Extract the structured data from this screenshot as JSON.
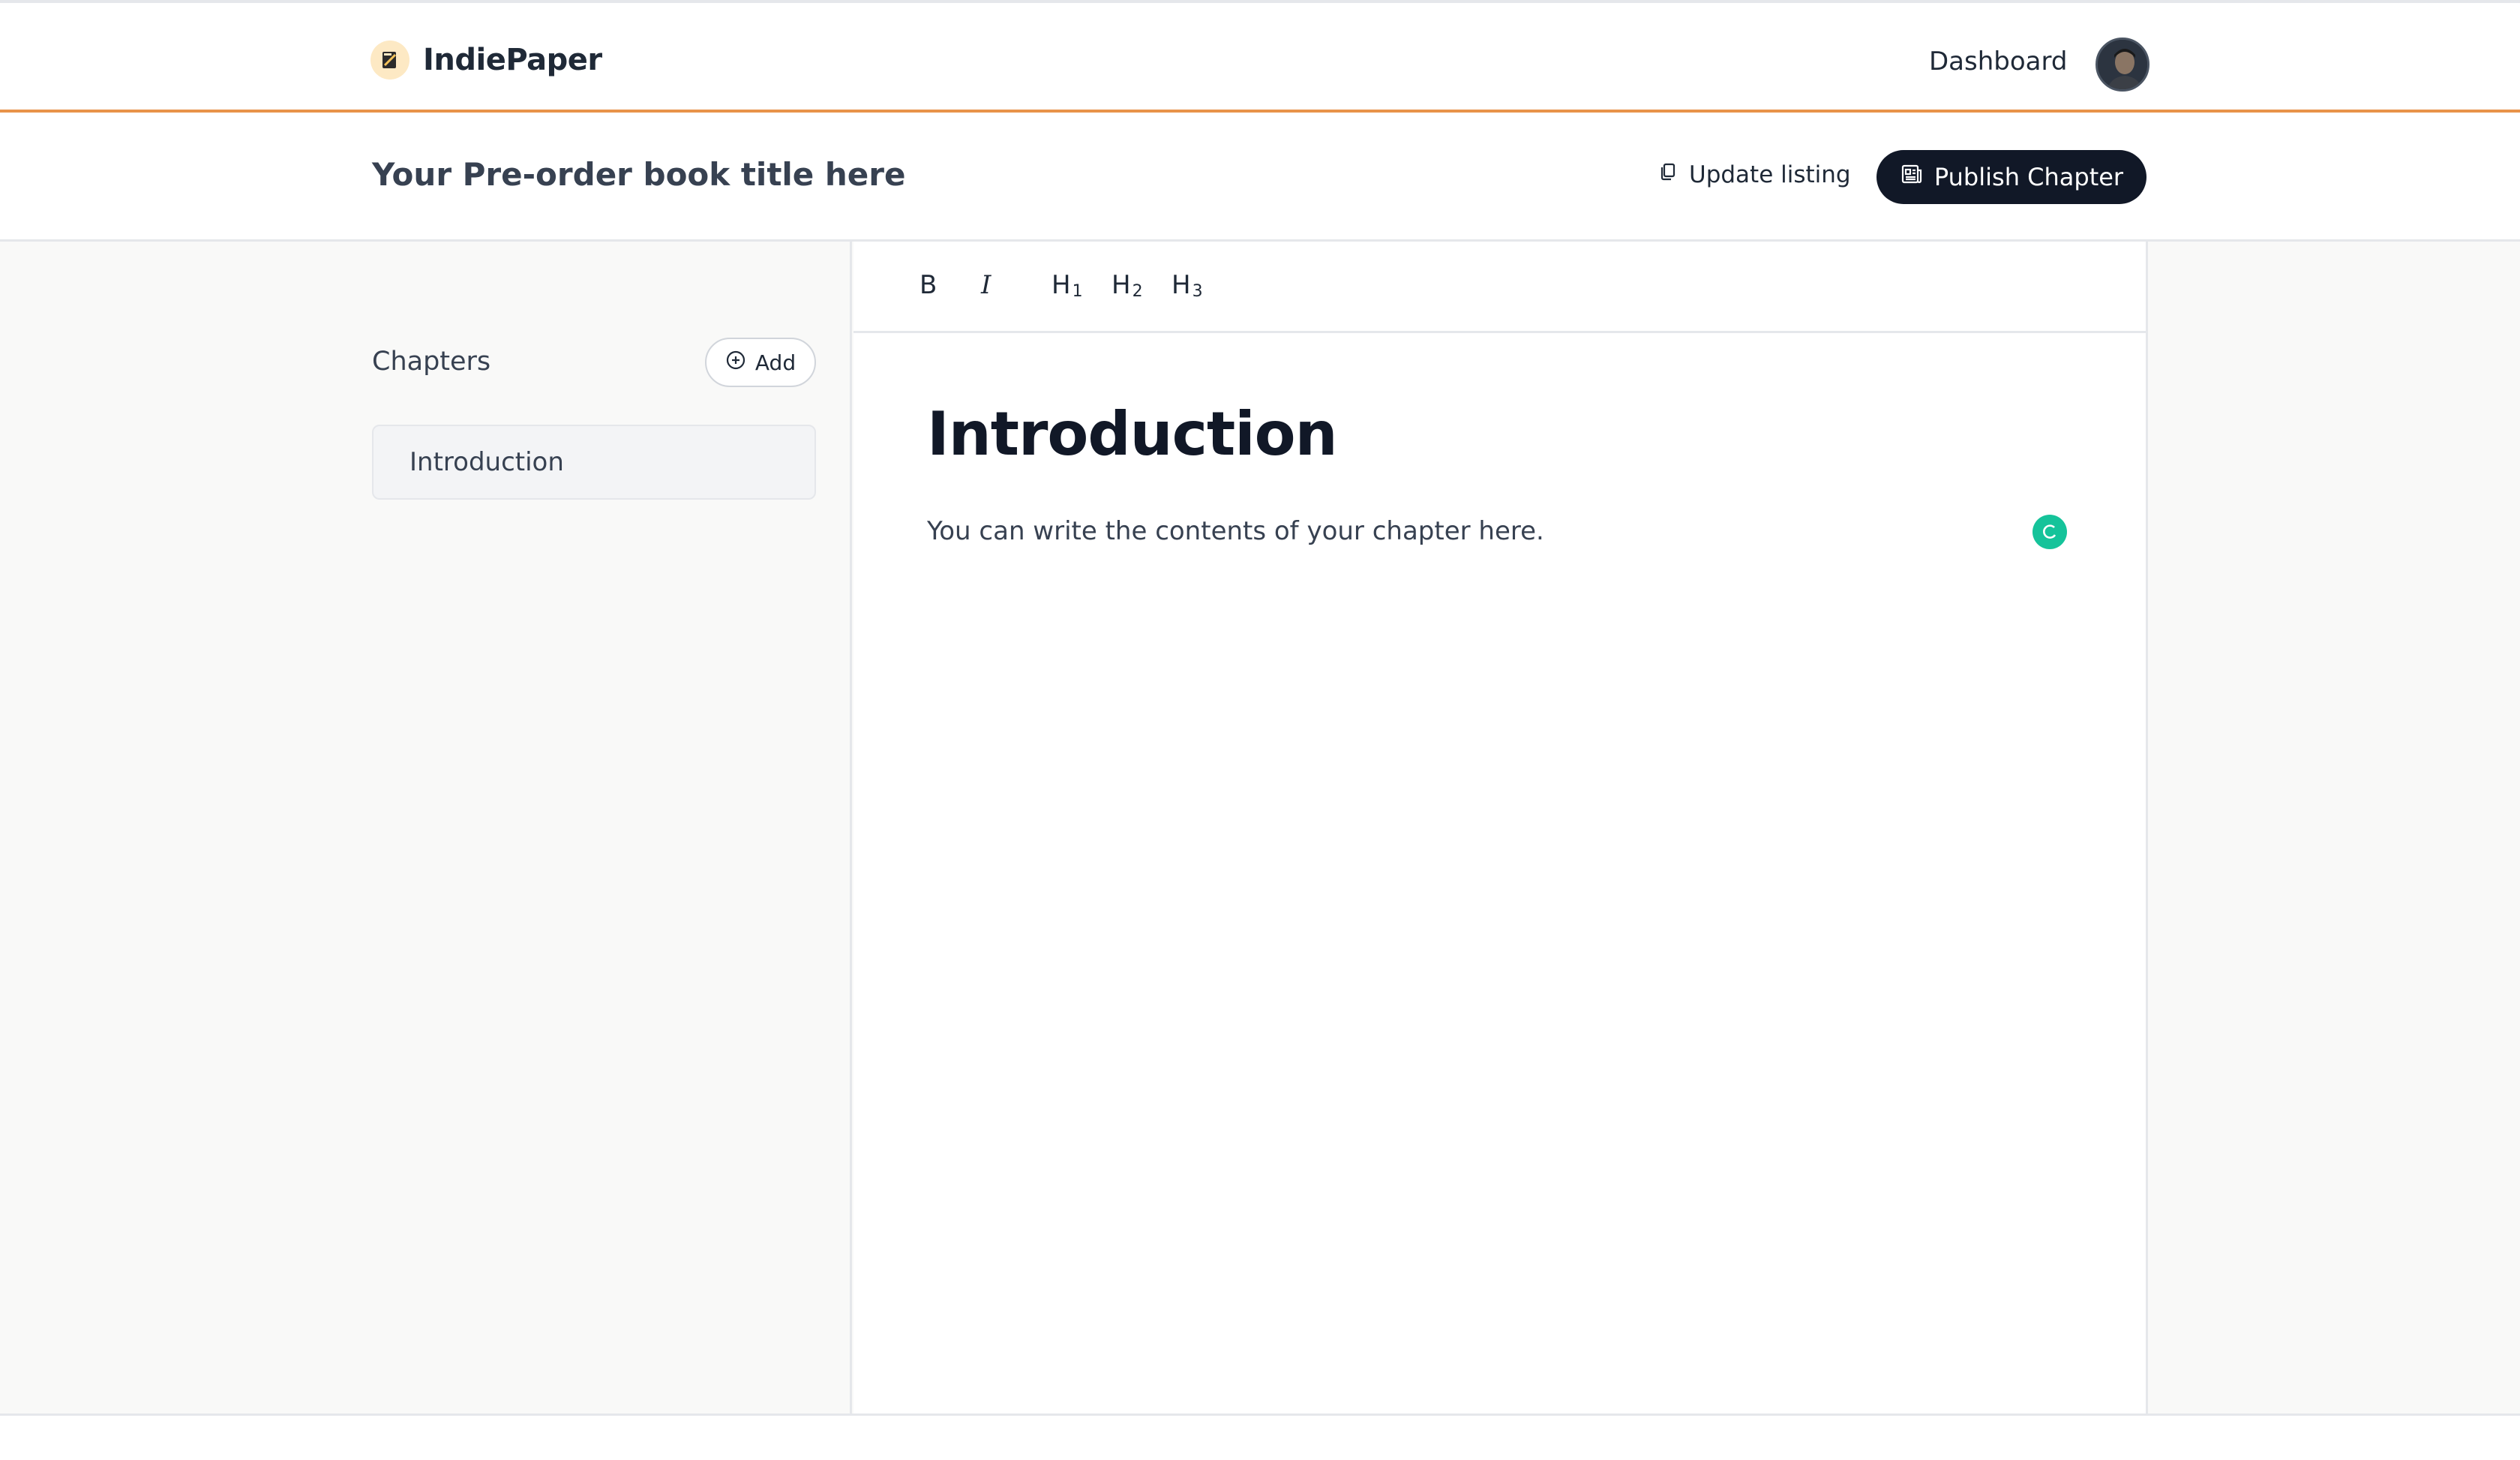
{
  "header": {
    "brand": "IndiePaper",
    "nav_dashboard": "Dashboard"
  },
  "titlebar": {
    "book_title": "Your Pre-order book title here",
    "update_label": "Update listing",
    "publish_label": "Publish Chapter"
  },
  "sidebar": {
    "title": "Chapters",
    "add_label": "Add",
    "chapters": [
      {
        "label": "Introduction"
      }
    ]
  },
  "toolbar": {
    "bold": "B",
    "italic": "I",
    "h1": "H",
    "h1_num": "1",
    "h2": "H",
    "h2_num": "2",
    "h3": "H",
    "h3_num": "3"
  },
  "document": {
    "heading": "Introduction",
    "body": "You can write the contents of your chapter here."
  },
  "colors": {
    "accent": "#e8934a",
    "primary_button": "#111827",
    "grammar_badge": "#15c39a"
  }
}
